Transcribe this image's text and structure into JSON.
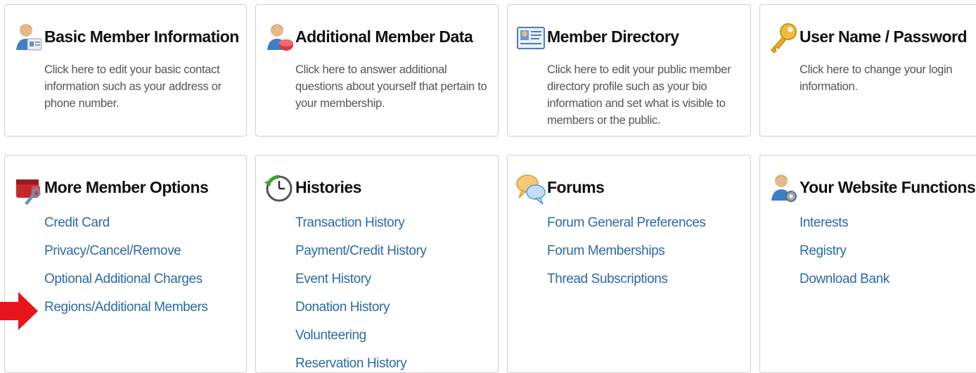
{
  "row1": [
    {
      "title": "Basic Member Information",
      "desc": "Click here to edit your basic contact information such as your address or phone number.",
      "icon": "member-card-icon"
    },
    {
      "title": "Additional Member Data",
      "desc": "Click here to answer additional questions about yourself that pertain to your membership.",
      "icon": "member-data-icon"
    },
    {
      "title": "Member Directory",
      "desc": "Click here to edit your public member directory profile such as your bio information and set what is visible to members or the public.",
      "icon": "directory-card-icon"
    },
    {
      "title": "User Name / Password",
      "desc": "Click here to change your login information.",
      "icon": "key-icon"
    }
  ],
  "row2": [
    {
      "title": "More Member Options",
      "icon": "wallet-icon",
      "links": [
        "Credit Card",
        "Privacy/Cancel/Remove",
        "Optional Additional Charges",
        "Regions/Additional Members"
      ]
    },
    {
      "title": "Histories",
      "icon": "history-clock-icon",
      "links": [
        "Transaction History",
        "Payment/Credit History",
        "Event History",
        "Donation History",
        "Volunteering",
        "Reservation History"
      ]
    },
    {
      "title": "Forums",
      "icon": "speech-bubbles-icon",
      "links": [
        "Forum General Preferences",
        "Forum Memberships",
        "Thread Subscriptions"
      ]
    },
    {
      "title": "Your Website Functions",
      "icon": "user-gear-icon",
      "links": [
        "Interests",
        "Registry",
        "Download Bank"
      ]
    }
  ],
  "colors": {
    "link": "#2b6aa8",
    "title": "#111111",
    "desc": "#555555",
    "arrow": "#e8141b"
  }
}
